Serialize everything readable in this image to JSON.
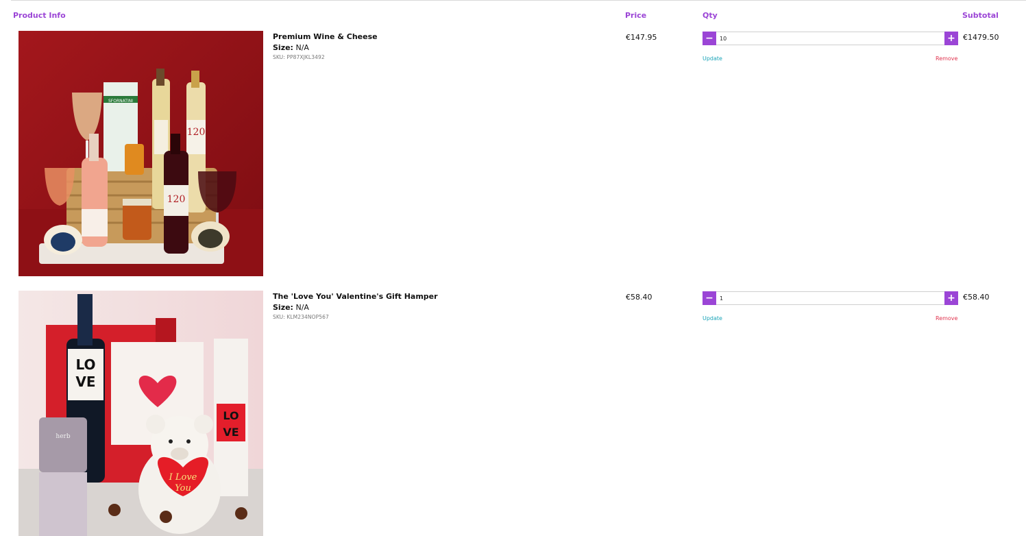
{
  "header": {
    "product_info": "Product Info",
    "price": "Price",
    "qty": "Qty",
    "subtotal": "Subtotal"
  },
  "items": [
    {
      "name": "Premium Wine & Cheese",
      "size_label": "Size:",
      "size_value": "N/A",
      "sku": "SKU: PP87XJKL3492",
      "price": "€147.95",
      "qty": "10",
      "subtotal": "€1479.50",
      "update_label": "Update",
      "remove_label": "Remove",
      "bottle_label_1": "120",
      "bottle_label_2": "120",
      "box_label": "SFORNATINI"
    },
    {
      "name": "The 'Love You' Valentine's Gift Hamper",
      "size_label": "Size:",
      "size_value": "N/A",
      "sku": "SKU: KLM234NOP567",
      "price": "€58.40",
      "qty": "1",
      "subtotal": "€58.40",
      "update_label": "Update",
      "remove_label": "Remove",
      "wine_label_top": "LO",
      "wine_label_bottom": "VE",
      "box_label_top": "LO",
      "box_label_bottom": "VE",
      "heart_text_1": "I Love",
      "heart_text_2": "You",
      "candle_brand": "herb"
    }
  ],
  "qty_controls": {
    "minus": "−",
    "plus": "+"
  },
  "colors": {
    "accent": "#9b45d6",
    "update": "#1aa4b8",
    "remove": "#e0344f"
  }
}
